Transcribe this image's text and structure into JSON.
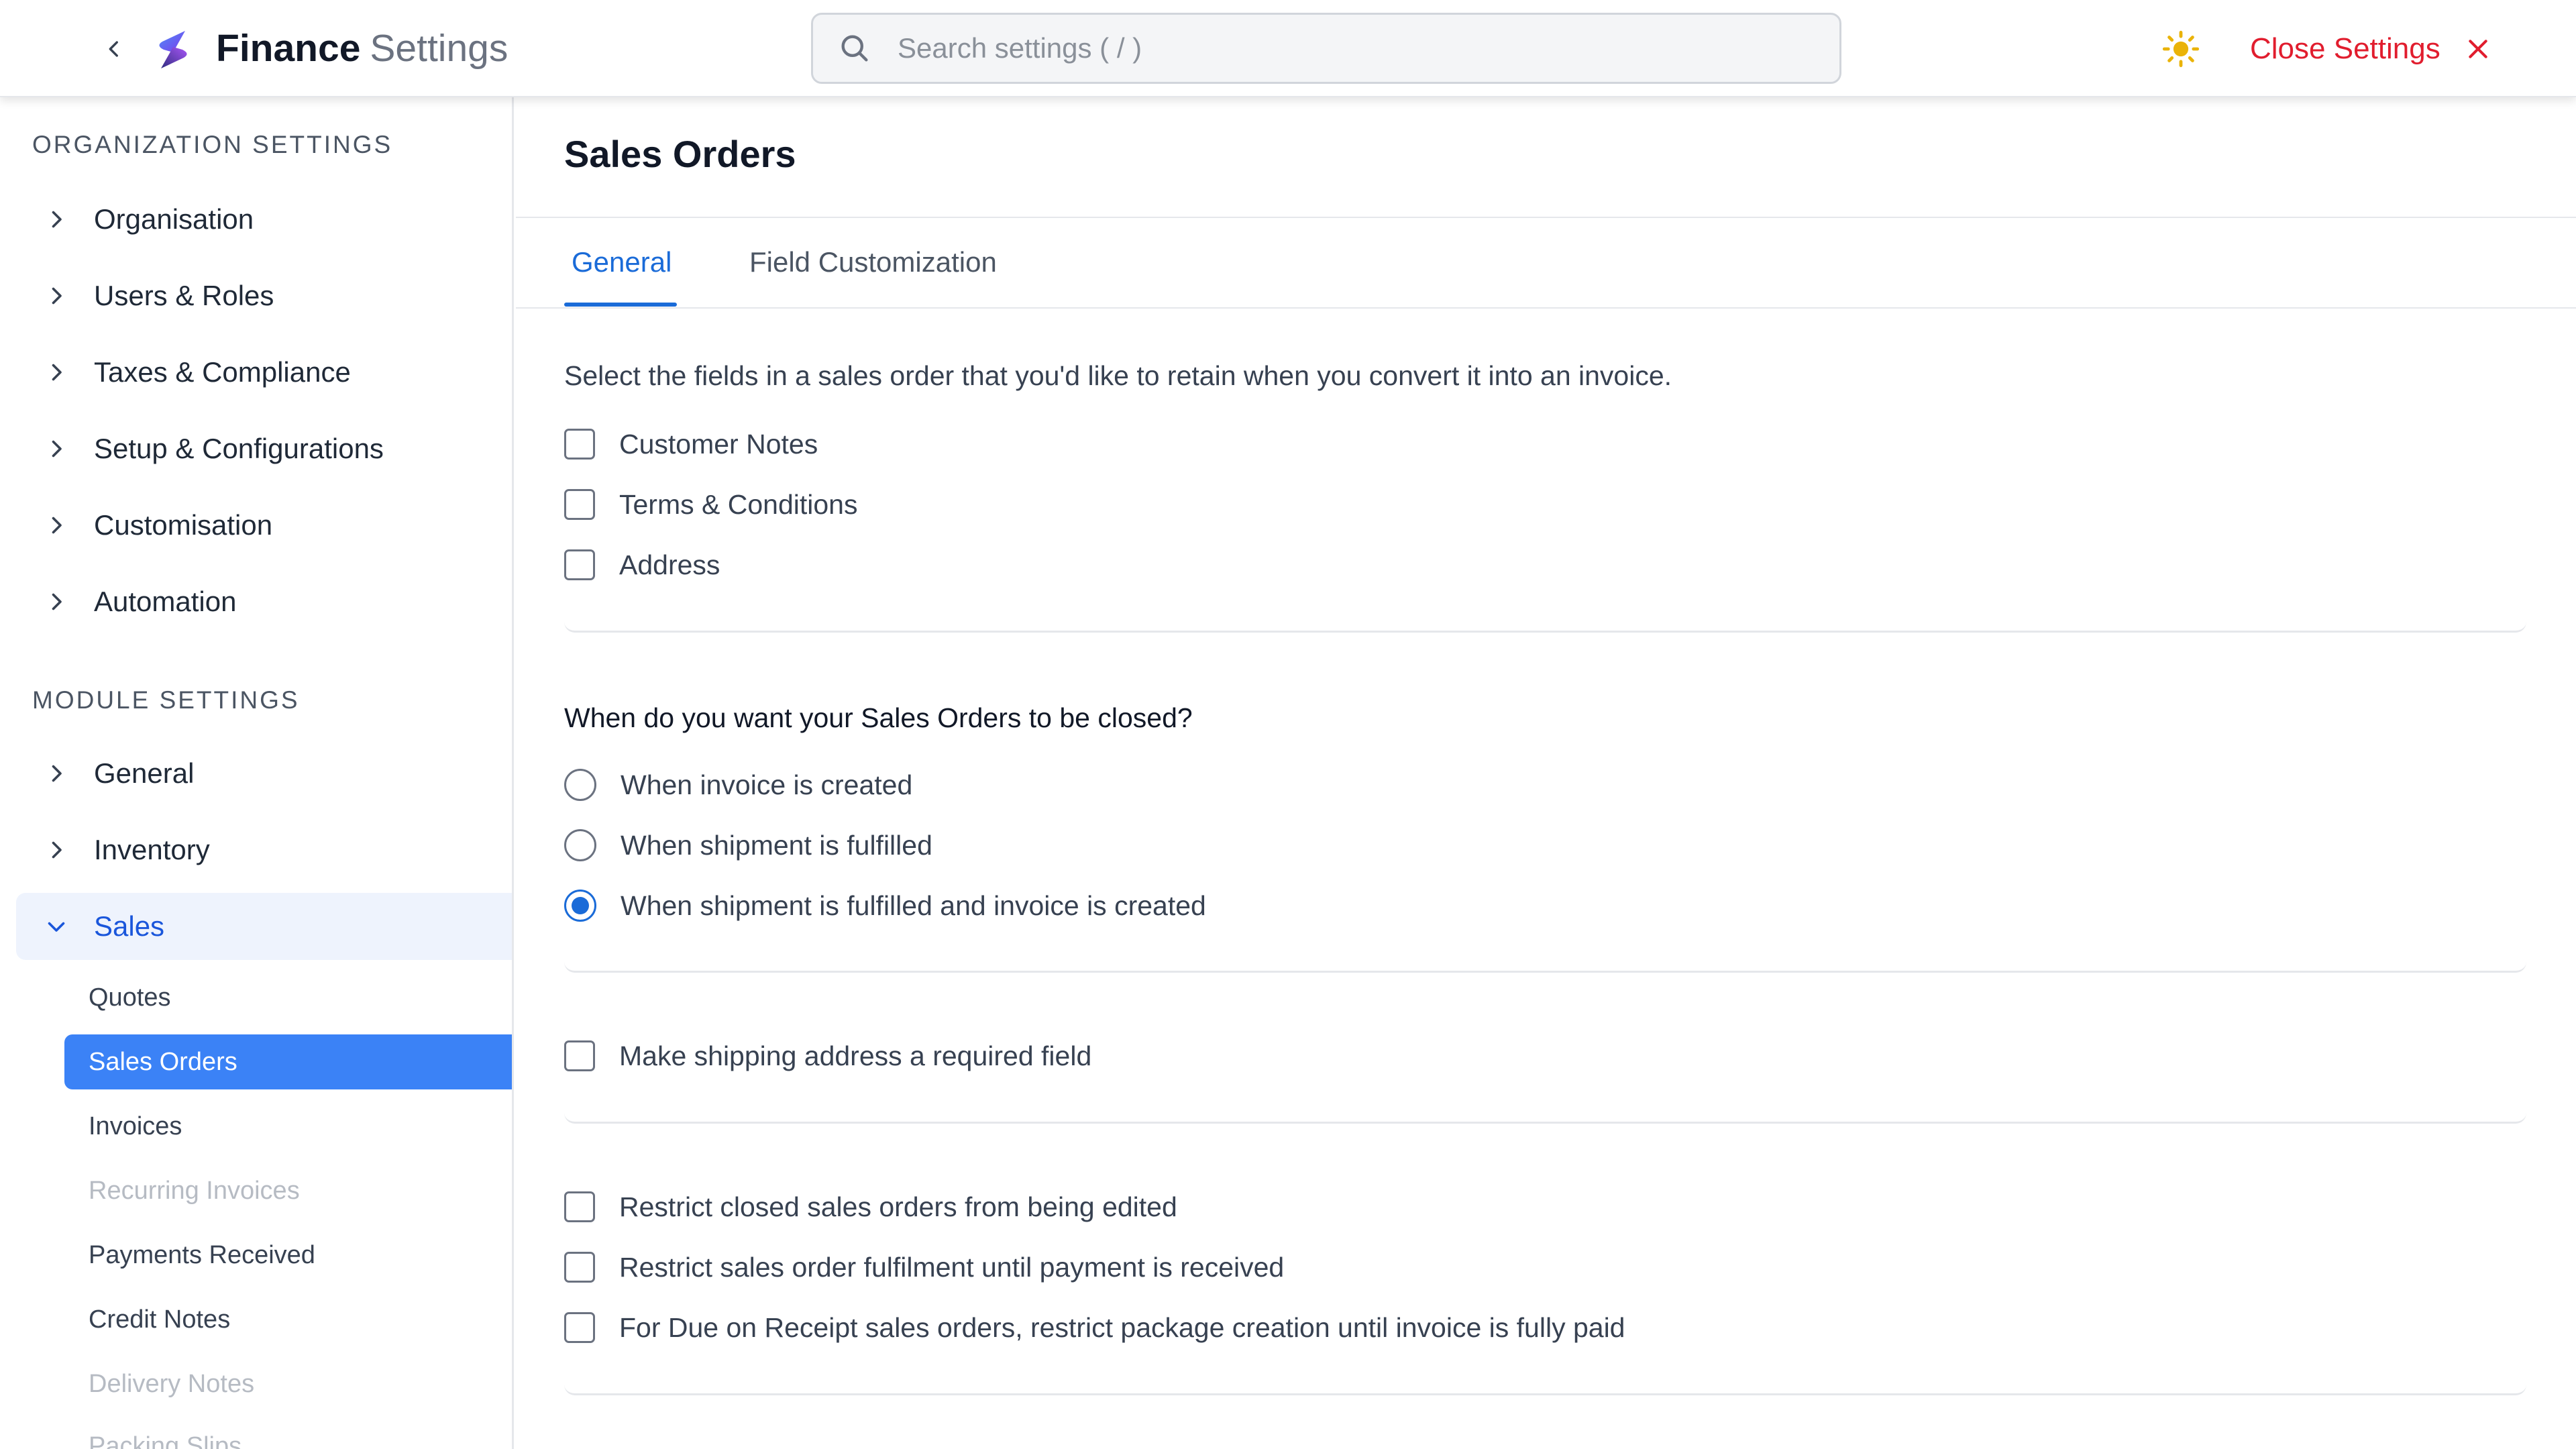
{
  "header": {
    "title_bold": "Finance",
    "title_light": "Settings",
    "search_placeholder": "Search settings ( / )",
    "close_label": "Close Settings"
  },
  "icons": {
    "back": "chevron-left-icon",
    "logo": "app-logo",
    "search": "search-icon",
    "theme": "sun-icon",
    "close": "close-icon"
  },
  "colors": {
    "accent": "#1a6bd8",
    "danger": "#e11d2e",
    "selected_bg": "#3b82f6",
    "active_bg": "#eef3fd",
    "sun": "#eab308"
  },
  "sidebar": {
    "org_title": "ORGANIZATION SETTINGS",
    "org_items": [
      {
        "label": "Organisation"
      },
      {
        "label": "Users & Roles"
      },
      {
        "label": "Taxes & Compliance"
      },
      {
        "label": "Setup & Configurations"
      },
      {
        "label": "Customisation"
      },
      {
        "label": "Automation"
      }
    ],
    "module_title": "MODULE SETTINGS",
    "module_items": [
      {
        "label": "General"
      },
      {
        "label": "Inventory"
      },
      {
        "label": "Sales",
        "expanded": true
      }
    ],
    "sales_sub": [
      {
        "label": "Quotes",
        "state": "normal"
      },
      {
        "label": "Sales Orders",
        "state": "selected"
      },
      {
        "label": "Invoices",
        "state": "normal"
      },
      {
        "label": "Recurring Invoices",
        "state": "disabled"
      },
      {
        "label": "Payments Received",
        "state": "normal"
      },
      {
        "label": "Credit Notes",
        "state": "normal"
      },
      {
        "label": "Delivery Notes",
        "state": "disabled"
      },
      {
        "label": "Packing Slips",
        "state": "disabled"
      }
    ]
  },
  "main": {
    "title": "Sales Orders",
    "tabs": [
      {
        "label": "General",
        "active": true
      },
      {
        "label": "Field Customization",
        "active": false
      }
    ],
    "retain": {
      "description": "Select the fields in a sales order that you'd like to retain when you convert it into an invoice.",
      "options": [
        {
          "label": "Customer Notes",
          "checked": false
        },
        {
          "label": "Terms & Conditions",
          "checked": false
        },
        {
          "label": "Address",
          "checked": false
        }
      ]
    },
    "close_question": {
      "label": "When do you want your Sales Orders to be closed?",
      "options": [
        {
          "label": "When invoice is created",
          "selected": false
        },
        {
          "label": "When shipment is fulfilled",
          "selected": false
        },
        {
          "label": "When shipment is fulfilled and invoice is created",
          "selected": true
        }
      ]
    },
    "shipping": {
      "label": "Make shipping address a required field",
      "checked": false
    },
    "restrictions": [
      {
        "label": "Restrict closed sales orders from being edited",
        "checked": false
      },
      {
        "label": "Restrict sales order fulfilment until payment is received",
        "checked": false
      },
      {
        "label": "For Due on Receipt sales orders, restrict package creation until invoice is fully paid",
        "checked": false
      }
    ]
  }
}
